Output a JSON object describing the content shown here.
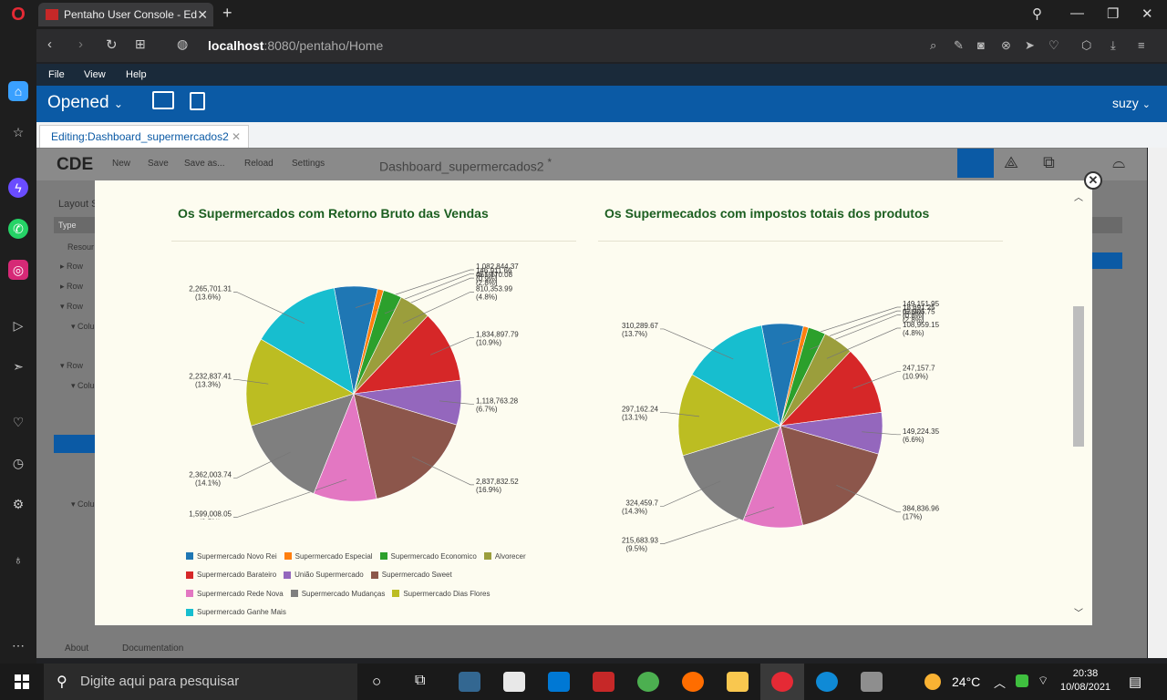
{
  "browser": {
    "tab_title": "Pentaho User Console - Ed",
    "new_tab": "+",
    "url_host": "localhost",
    "url_path": ":8080/pentaho/Home"
  },
  "pentaho": {
    "menu": [
      "File",
      "View",
      "Help"
    ],
    "perspective": "Opened",
    "user": "suzy",
    "editing_tab": "Editing:Dashboard_supermercados2"
  },
  "cde": {
    "logo": "CDE",
    "menu": [
      "New",
      "Save",
      "Save as...",
      "Reload",
      "Settings"
    ],
    "dashboard_name": "Dashboard_supermercados2",
    "modified_mark": "*",
    "layout_label": "Layout S",
    "type_label": "Type",
    "tree": [
      "Resour",
      "Row",
      "Row",
      "Row",
      "Colu",
      "Row",
      "Colu",
      "Colu"
    ],
    "footer": [
      "About",
      "Documentation"
    ]
  },
  "chart_data": [
    {
      "type": "pie",
      "title": "Os Supermercados com Retorno Bruto das Vendas",
      "series": [
        {
          "name": "Supermercado Novo Rei",
          "value_label": "1,082,844.37",
          "pct_label": "(6.5%)",
          "value": 6.5,
          "color": "#1f77b4"
        },
        {
          "name": "Supermercado Especial",
          "value_label": "146,911.66",
          "pct_label": "(0.9%)",
          "value": 0.9,
          "color": "#ff7f0e"
        },
        {
          "name": "Supermercado Economico",
          "value_label": "467,770.08",
          "pct_label": "(2.8%)",
          "value": 2.8,
          "color": "#2ca02c"
        },
        {
          "name": "Alvorecer",
          "value_label": "810,353.99",
          "pct_label": "(4.8%)",
          "value": 4.8,
          "color": "#9b9e3c"
        },
        {
          "name": "Supermercado Barateiro",
          "value_label": "1,834,897.79",
          "pct_label": "(10.9%)",
          "value": 10.9,
          "color": "#d62728"
        },
        {
          "name": "União Supermercado",
          "value_label": "1,118,763.28",
          "pct_label": "(6.7%)",
          "value": 6.7,
          "color": "#9467bd"
        },
        {
          "name": "Supermercado Sweet",
          "value_label": "2,837,832.52",
          "pct_label": "(16.9%)",
          "value": 16.9,
          "color": "#8c564b"
        },
        {
          "name": "Supermercado Rede Nova",
          "value_label": "1,599,008.05",
          "pct_label": "(9.5%)",
          "value": 9.5,
          "color": "#e377c2"
        },
        {
          "name": "Supermercado Mudanças",
          "value_label": "2,362,003.74",
          "pct_label": "(14.1%)",
          "value": 14.1,
          "color": "#7f7f7f"
        },
        {
          "name": "Supermercado Dias Flores",
          "value_label": "2,232,837.41",
          "pct_label": "(13.3%)",
          "value": 13.3,
          "color": "#bcbd22"
        },
        {
          "name": "Supermercado Ganhe Mais",
          "value_label": "2,265,701.31",
          "pct_label": "(13.6%)",
          "value": 13.6,
          "color": "#17becf"
        }
      ]
    },
    {
      "type": "pie",
      "title": "Os Supermecados com impostos totais dos produtos",
      "series": [
        {
          "value_label": "149,151.95",
          "pct_label": "(6.6%)",
          "value": 6.6,
          "color": "#1f77b4"
        },
        {
          "value_label": "18,691.25",
          "pct_label": "(0.8%)",
          "value": 0.8,
          "color": "#ff7f0e"
        },
        {
          "value_label": "63,905.75",
          "pct_label": "(2.8%)",
          "value": 2.8,
          "color": "#2ca02c"
        },
        {
          "value_label": "108,959.15",
          "pct_label": "(4.8%)",
          "value": 4.8,
          "color": "#9b9e3c"
        },
        {
          "value_label": "247,157.7",
          "pct_label": "(10.9%)",
          "value": 10.9,
          "color": "#d62728"
        },
        {
          "value_label": "149,224.35",
          "pct_label": "(6.6%)",
          "value": 6.6,
          "color": "#9467bd"
        },
        {
          "value_label": "384,836.96",
          "pct_label": "(17%)",
          "value": 17.0,
          "color": "#8c564b"
        },
        {
          "value_label": "215,683.93",
          "pct_label": "(9.5%)",
          "value": 9.5,
          "color": "#e377c2"
        },
        {
          "value_label": "324,459.7",
          "pct_label": "(14.3%)",
          "value": 14.3,
          "color": "#7f7f7f"
        },
        {
          "value_label": "297,162.24",
          "pct_label": "(13.1%)",
          "value": 13.1,
          "color": "#bcbd22"
        },
        {
          "value_label": "310,289.67",
          "pct_label": "(13.7%)",
          "value": 13.7,
          "color": "#17becf"
        }
      ]
    }
  ],
  "taskbar": {
    "search_placeholder": "Digite aqui para pesquisar",
    "temperature": "24°C",
    "time": "20:38",
    "date": "10/08/2021"
  }
}
